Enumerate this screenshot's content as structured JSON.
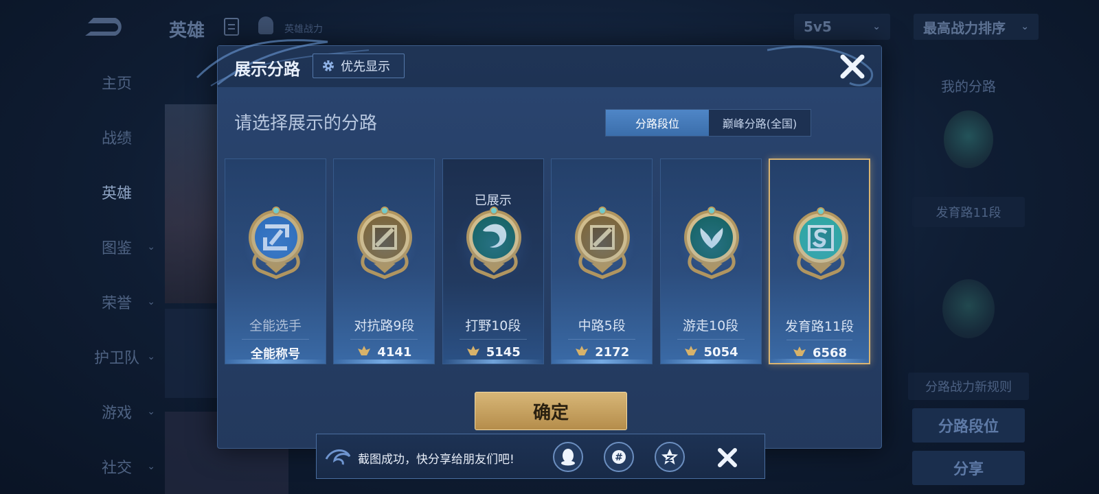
{
  "background": {
    "top_title": "英雄",
    "top_subtitle": "英雄战力",
    "mode_select": "5v5",
    "sort_select": "最高战力排序",
    "sidebar": [
      {
        "label": "主页",
        "chevron": false
      },
      {
        "label": "战绩",
        "chevron": false
      },
      {
        "label": "英雄",
        "chevron": false,
        "active": true
      },
      {
        "label": "图鉴",
        "chevron": true
      },
      {
        "label": "荣誉",
        "chevron": true
      },
      {
        "label": "护卫队",
        "chevron": true
      },
      {
        "label": "游戏",
        "chevron": true
      },
      {
        "label": "社交",
        "chevron": true
      }
    ],
    "right_panel": {
      "title": "我的分路",
      "current_lane": "发育路11段",
      "rule_btn": "分路战力新规则",
      "lane_rank_btn": "分路段位",
      "share_btn": "分享"
    }
  },
  "modal": {
    "title": "展示分路",
    "priority_btn": "优先显示",
    "prompt": "请选择展示的分路",
    "tabs": [
      {
        "label": "分路段位",
        "active": true
      },
      {
        "label": "巅峰分路(全国)",
        "active": false
      }
    ],
    "cards": [
      {
        "name": "全能选手",
        "value": "全能称号",
        "badge": "all-round-badge",
        "shown": false,
        "selected": false,
        "has_icon": false
      },
      {
        "name": "对抗路9段",
        "value": "4141",
        "badge": "clash-lane-badge",
        "shown": false,
        "selected": false,
        "has_icon": true
      },
      {
        "name": "打野10段",
        "value": "5145",
        "badge": "jungle-badge",
        "shown": true,
        "shown_label": "已展示",
        "selected": false,
        "has_icon": true
      },
      {
        "name": "中路5段",
        "value": "2172",
        "badge": "mid-lane-badge",
        "shown": false,
        "selected": false,
        "has_icon": true
      },
      {
        "name": "游走10段",
        "value": "5054",
        "badge": "roam-badge",
        "shown": false,
        "selected": false,
        "has_icon": true
      },
      {
        "name": "发育路11段",
        "value": "6568",
        "badge": "farm-lane-badge",
        "shown": false,
        "selected": true,
        "has_icon": true
      }
    ],
    "confirm": "确定"
  },
  "toast": {
    "text": "截图成功，快分享给朋友们吧!",
    "share_targets": [
      "qq-icon",
      "moments-icon",
      "qzone-icon"
    ]
  },
  "colors": {
    "gold": "#d9b472",
    "teal": "#31c6b0",
    "blue_accent": "#4f86c7"
  }
}
